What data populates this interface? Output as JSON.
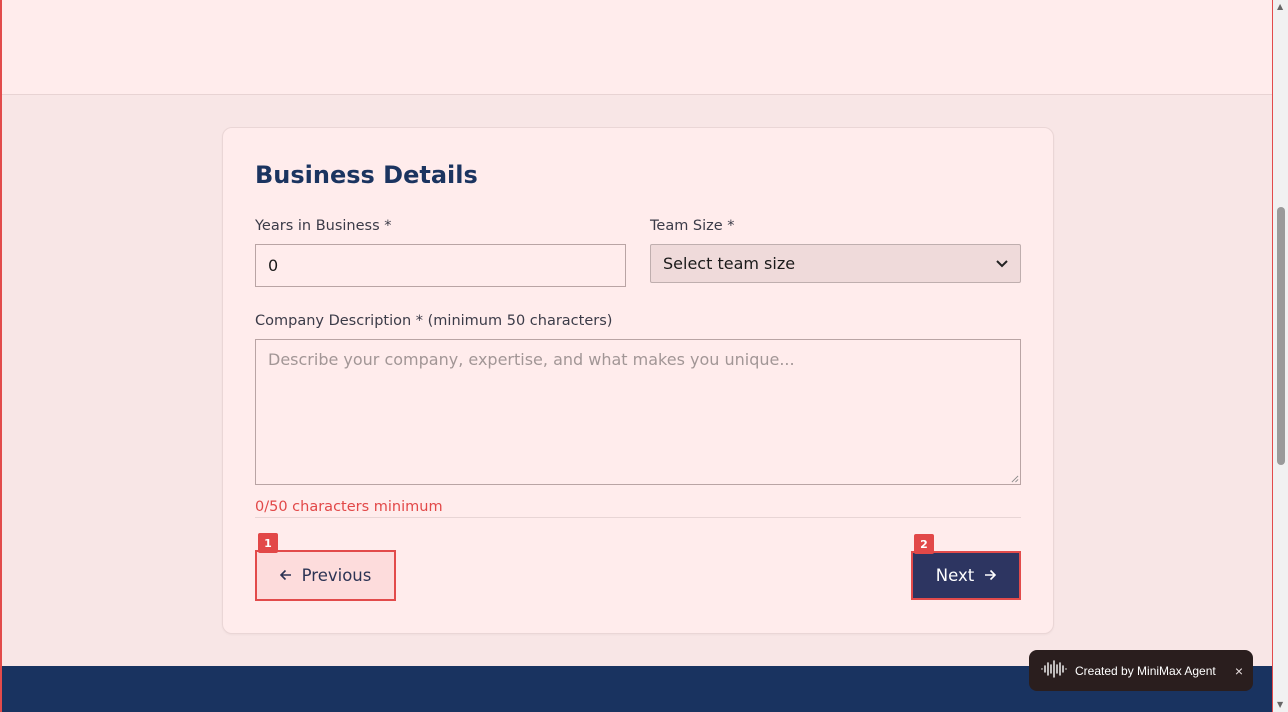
{
  "form": {
    "title": "Business Details",
    "years_label": "Years in Business *",
    "years_value": "0",
    "team_label": "Team Size *",
    "team_selected": "Select team size",
    "description_label": "Company Description * (minimum 50 characters)",
    "description_placeholder": "Describe your company, expertise, and what makes you unique...",
    "char_count": "0/50 characters minimum",
    "previous_label": "Previous",
    "next_label": "Next",
    "previous_badge": "1",
    "next_badge": "2"
  },
  "toast": {
    "text": "Created by MiniMax Agent",
    "close": "×"
  },
  "colors": {
    "page_bg": "#f8e6e6",
    "title": "#1b3460",
    "accent_border": "#e24b4b",
    "next_bg": "#2d3561",
    "footer": "#193360"
  },
  "icons": {
    "previous": "arrow-left-icon",
    "next": "arrow-right-icon",
    "select": "chevron-down-icon",
    "toast": "waveform-icon"
  }
}
